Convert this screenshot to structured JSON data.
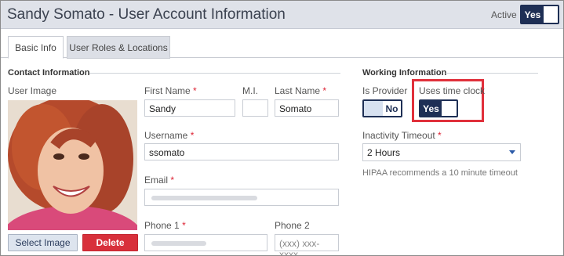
{
  "header": {
    "title": "Sandy Somato - User Account Information",
    "active_label": "Active",
    "active_toggle": "Yes"
  },
  "tabs": [
    {
      "label": "Basic Info",
      "active": true
    },
    {
      "label": "User Roles & Locations",
      "active": false
    }
  ],
  "contact": {
    "heading": "Contact Information",
    "user_image_label": "User Image",
    "first_name_label": "First Name",
    "first_name_value": "Sandy",
    "mi_label": "M.I.",
    "mi_value": "",
    "last_name_label": "Last Name",
    "last_name_value": "Somato",
    "username_label": "Username",
    "username_value": "ssomato",
    "email_label": "Email",
    "phone1_label": "Phone 1",
    "phone2_label": "Phone 2",
    "phone2_placeholder": "(xxx) xxx-xxxx",
    "required_mark": "*",
    "select_image_button": "Select Image",
    "delete_button": "Delete"
  },
  "working": {
    "heading": "Working Information",
    "is_provider_label": "Is Provider",
    "is_provider_toggle": "No",
    "uses_time_clock_label": "Uses time clock",
    "uses_time_clock_toggle": "Yes",
    "inactivity_label": "Inactivity Timeout",
    "inactivity_value": "2 Hours",
    "hint": "HIPAA recommends a 10 minute timeout"
  },
  "colors": {
    "header_bg": "#dfe2e9",
    "toggle_navy": "#1e2f55",
    "delete_red": "#d8303b",
    "highlight_red": "#e0303b",
    "required_red": "#dd2233"
  }
}
